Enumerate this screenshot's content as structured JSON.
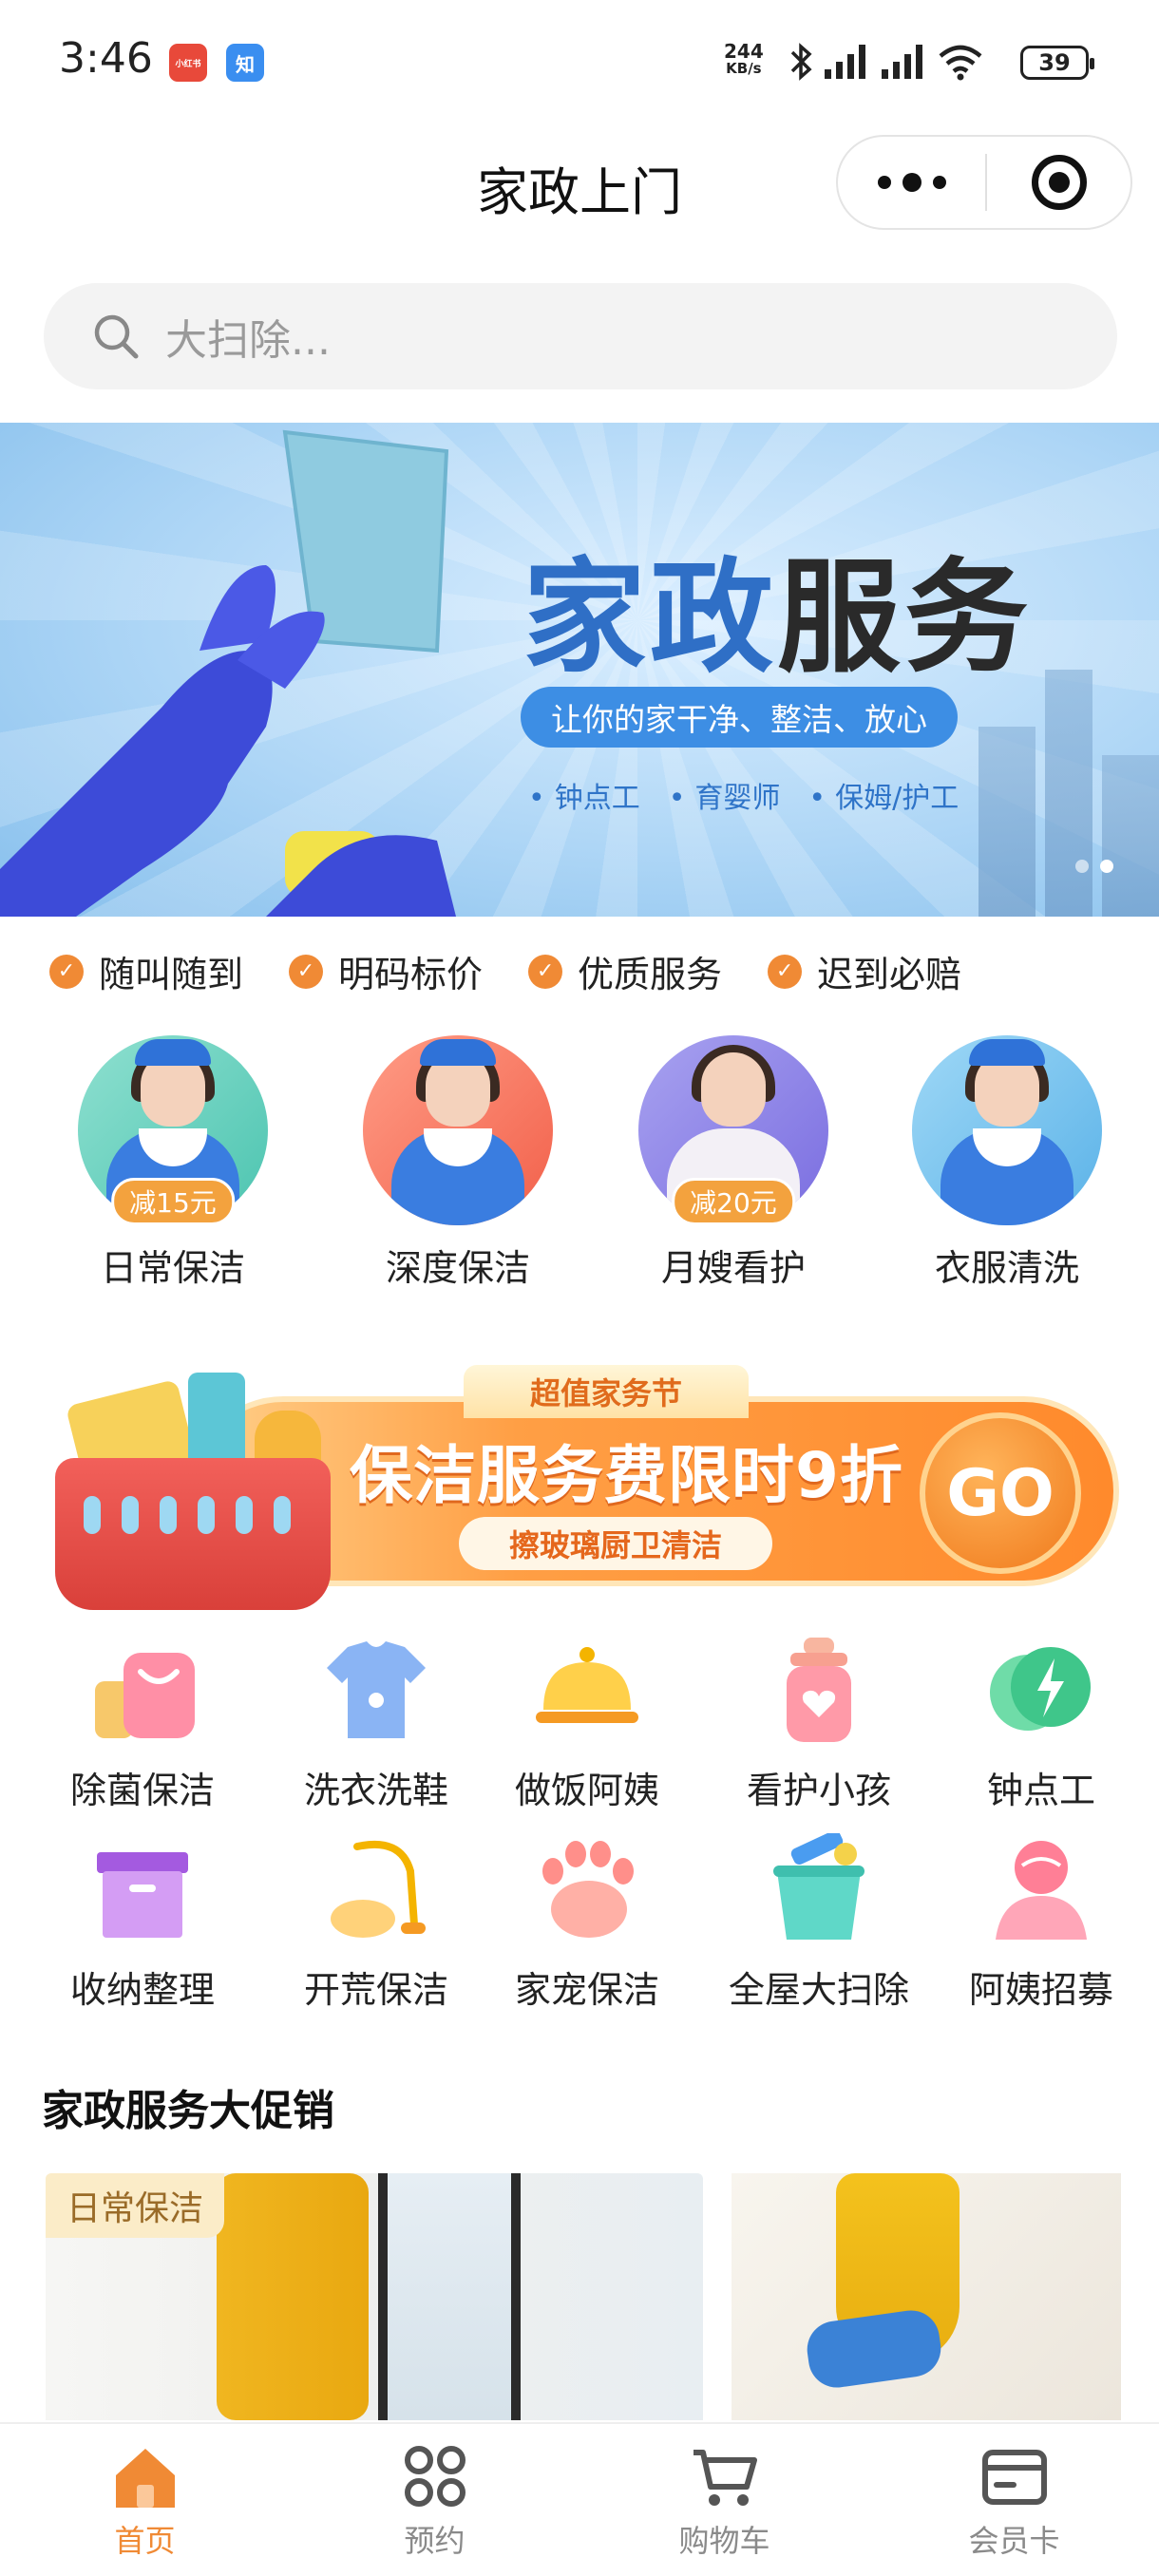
{
  "status_bar": {
    "time": "3:46",
    "app_chip_1": "小红书",
    "app_chip_2": "知",
    "net_speed_value": "244",
    "net_speed_unit": "KB/s",
    "battery": "39"
  },
  "header": {
    "title": "家政上门"
  },
  "search": {
    "placeholder": "大扫除..."
  },
  "banner": {
    "title_part1": "家政",
    "title_part2": "服务",
    "slogan": "让你的家干净、整洁、放心",
    "tags": [
      "钟点工",
      "育婴师",
      "保姆/护工"
    ]
  },
  "guarantees": [
    "随叫随到",
    "明码标价",
    "优质服务",
    "迟到必赔"
  ],
  "featured_services": [
    {
      "label": "日常保洁",
      "badge": "减15元"
    },
    {
      "label": "深度保洁",
      "badge": ""
    },
    {
      "label": "月嫂看护",
      "badge": "减20元"
    },
    {
      "label": "衣服清洗",
      "badge": ""
    }
  ],
  "promo": {
    "tab": "超值家务节",
    "title": "保洁服务费限时9折",
    "subtitle": "擦玻璃厨卫清洁",
    "go": "GO"
  },
  "categories": [
    {
      "label": "除菌保洁",
      "icon": "bag-icon"
    },
    {
      "label": "洗衣洗鞋",
      "icon": "shirt-icon"
    },
    {
      "label": "做饭阿姨",
      "icon": "cloche-icon"
    },
    {
      "label": "看护小孩",
      "icon": "baby-bottle-icon"
    },
    {
      "label": "钟点工",
      "icon": "lightning-icon"
    },
    {
      "label": "收纳整理",
      "icon": "storage-box-icon"
    },
    {
      "label": "开荒保洁",
      "icon": "vacuum-icon"
    },
    {
      "label": "家宠保洁",
      "icon": "paw-icon"
    },
    {
      "label": "全屋大扫除",
      "icon": "bucket-icon"
    },
    {
      "label": "阿姨招募",
      "icon": "recruit-icon"
    }
  ],
  "section": {
    "title": "家政服务大促销",
    "card1_tag": "日常保洁"
  },
  "bottom_nav": [
    {
      "label": "首页",
      "icon": "home-icon",
      "active": true
    },
    {
      "label": "预约",
      "icon": "grid-icon",
      "active": false
    },
    {
      "label": "购物车",
      "icon": "cart-icon",
      "active": false
    },
    {
      "label": "会员卡",
      "icon": "card-icon",
      "active": false
    }
  ],
  "colors": {
    "accent": "#f08a35",
    "banner_blue": "#3d8ee4"
  }
}
